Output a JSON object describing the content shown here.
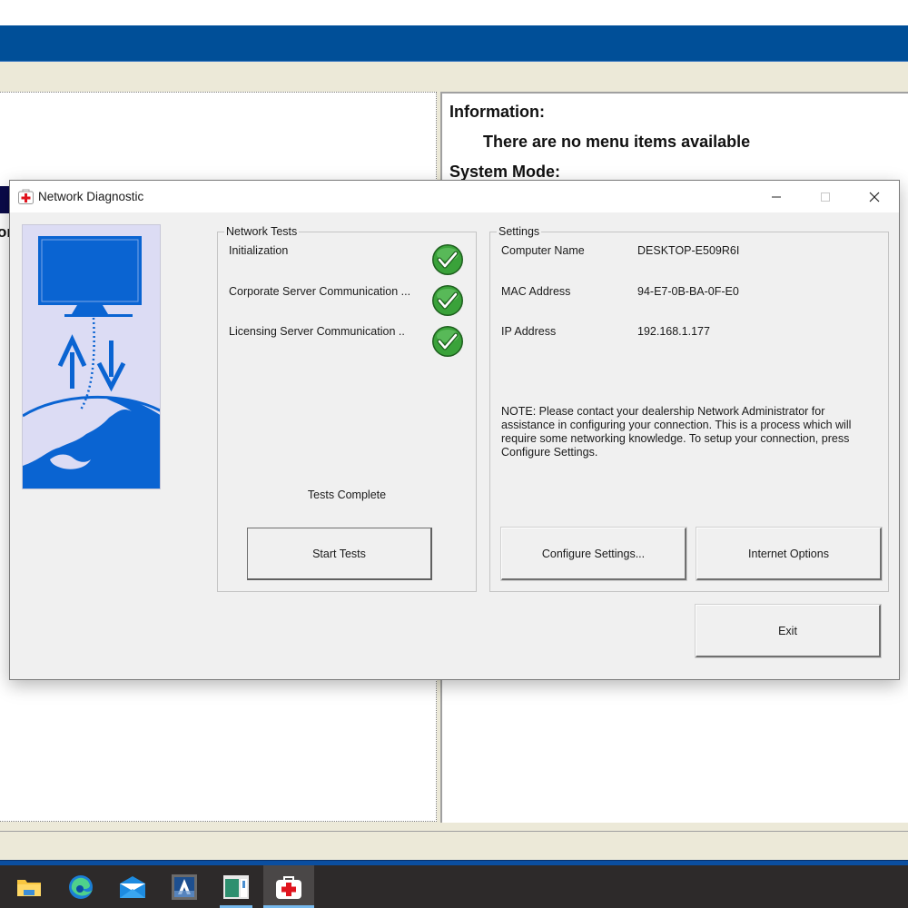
{
  "background_app": {
    "info_title": "Information:",
    "info_text": "There are no menu items available",
    "system_mode": "System Mode:",
    "left_partial_text": "or"
  },
  "dialog": {
    "title": "Network Diagnostic",
    "window_controls": {
      "minimize": "—",
      "maximize": "☐",
      "close": "✕"
    },
    "network_tests": {
      "legend": "Network Tests",
      "items": [
        {
          "label": "Initialization",
          "status": "passed"
        },
        {
          "label": "Corporate Server Communication ...",
          "status": "passed"
        },
        {
          "label": "Licensing Server Communication ..",
          "status": "passed"
        }
      ],
      "status_text": "Tests Complete",
      "start_button": "Start Tests"
    },
    "settings": {
      "legend": "Settings",
      "rows": [
        {
          "label": "Computer Name",
          "value": "DESKTOP-E509R6I"
        },
        {
          "label": "MAC Address",
          "value": "94-E7-0B-BA-0F-E0"
        },
        {
          "label": "IP Address",
          "value": "192.168.1.177"
        }
      ],
      "note": "NOTE: Please contact your dealership Network Administrator for assistance in configuring your connection. This is a process which will require some networking knowledge. To setup your connection, press Configure Settings.",
      "configure_button": "Configure Settings...",
      "internet_options_button": "Internet Options"
    },
    "exit_button": "Exit"
  },
  "taskbar": {
    "items": [
      {
        "name": "file-explorer",
        "active": false
      },
      {
        "name": "edge",
        "active": false
      },
      {
        "name": "mail",
        "active": false
      },
      {
        "name": "app-a",
        "active": false
      },
      {
        "name": "app-window",
        "active": false
      },
      {
        "name": "network-diagnostic",
        "active": true
      }
    ]
  },
  "colors": {
    "header_blue": "#004f98",
    "check_green": "#3aa23a",
    "graphic_blue": "#0a64d2",
    "graphic_bg": "#dcdcf4",
    "taskbar_bg": "#2d2a2a"
  }
}
